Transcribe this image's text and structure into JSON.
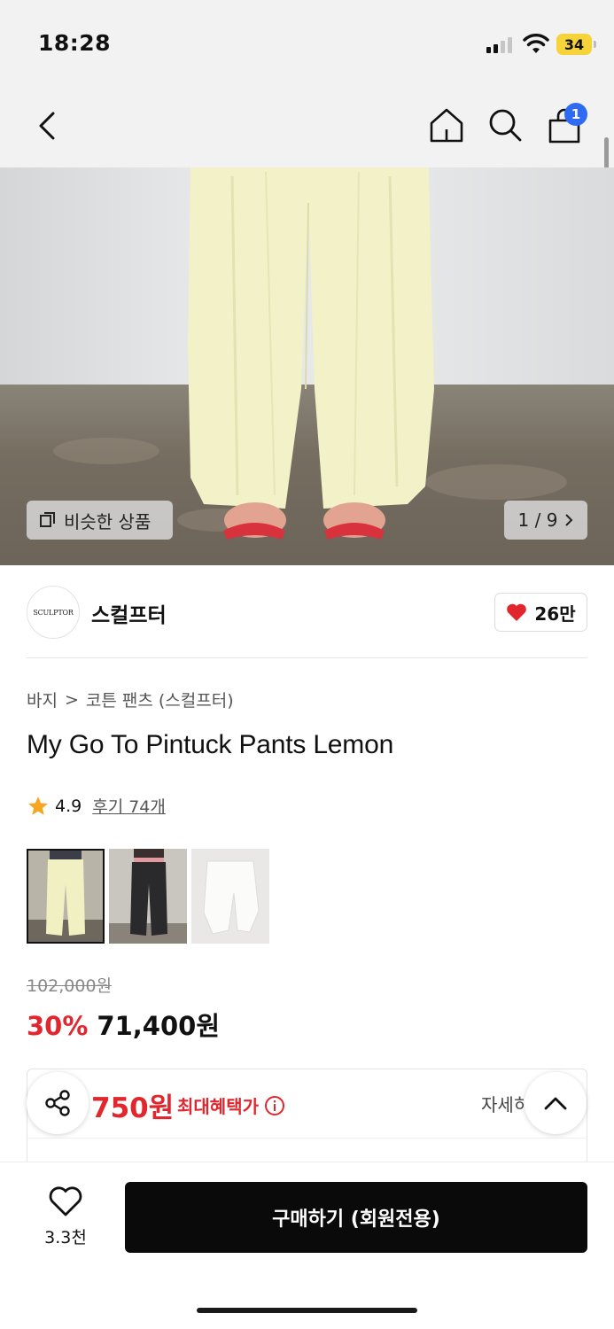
{
  "status_bar": {
    "time": "18:28",
    "battery": "34"
  },
  "header": {
    "cart_badge": "1"
  },
  "hero": {
    "similar_label": "비슷한 상품",
    "pager": "1 / 9"
  },
  "brand": {
    "logo_text": "SCULPTOR",
    "name": "스컬프터",
    "likes": "26만"
  },
  "breadcrumb": {
    "category": "바지",
    "separator": ">",
    "subcategory": "코튼 팬츠 (스컬프터)"
  },
  "product": {
    "title": "My Go To Pintuck Pants Lemon",
    "rating": "4.9",
    "reviews": "후기 74개",
    "thumbnails": [
      "lemon",
      "black",
      "white"
    ],
    "original_price": "102,000원",
    "discount": "30%",
    "price": "71,400원"
  },
  "benefit": {
    "amount": "750원",
    "label": "최대혜택가",
    "detail": "자세히"
  },
  "bottom_bar": {
    "wish_count": "3.3천",
    "buy_label": "구매하기 (회원전용)"
  },
  "colors": {
    "accent_red": "#e2262e",
    "badge_blue": "#2f6bf2",
    "buy_button": "#0a0a0a"
  }
}
